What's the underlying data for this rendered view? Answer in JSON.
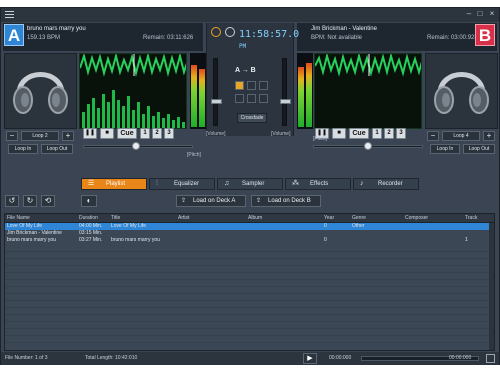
{
  "deckA": {
    "letter": "A",
    "song": "bruno mars marry you",
    "bpm": "159.13 BPM",
    "remain": "Remain: 03:11:626",
    "loop_label": "Loop 2",
    "loop_in": "Loop In",
    "loop_out": "Loop Out",
    "cue": "Cue",
    "hot1": "1",
    "hot2": "2",
    "hot3": "3",
    "volume": "[Volume]",
    "pitch": "[Pitch]"
  },
  "deckB": {
    "letter": "B",
    "song": "Jim Brickman - Valentine",
    "bpm": "BPM: Not available",
    "remain": "Remain: 03:00:928",
    "loop_label": "Loop 4",
    "loop_in": "Loop In",
    "loop_out": "Loop Out",
    "cue": "Cue",
    "hot1": "1",
    "hot2": "2",
    "hot3": "3",
    "volume": "[Volume]",
    "pitch": "[Pitch]"
  },
  "mixer": {
    "clock": "11:58:57.0",
    "ampm": "PM",
    "ab_label": "A → B",
    "crossfade": "Crossfade"
  },
  "tabs": [
    {
      "label": "Playlist",
      "icon": "playlist-icon",
      "active": true
    },
    {
      "label": "Equalizer",
      "icon": "equalizer-icon",
      "active": false
    },
    {
      "label": "Sampler",
      "icon": "music-note-icon",
      "active": false
    },
    {
      "label": "Effects",
      "icon": "effects-icon",
      "active": false
    },
    {
      "label": "Recorder",
      "icon": "microphone-icon",
      "active": false
    }
  ],
  "toolbar": {
    "load_a": "Load on Deck A",
    "load_b": "Load on Deck B"
  },
  "table": {
    "columns": [
      "File Name",
      "Duration",
      "Title",
      "Artist",
      "Album",
      "Year",
      "Genre",
      "Composer",
      "Track"
    ],
    "rows": [
      {
        "file": "Love Of My Life",
        "duration": "04:00 Min.",
        "title": "Love Of My Life",
        "artist": "",
        "album": "",
        "year": "0",
        "genre": "Other",
        "composer": "",
        "track": ""
      },
      {
        "file": "Jim Brickman - Valentine",
        "duration": "03:15 Min.",
        "title": "",
        "artist": "",
        "album": "",
        "year": "",
        "genre": "",
        "composer": "",
        "track": ""
      },
      {
        "file": "bruno mars marry you",
        "duration": "03:27 Min.",
        "title": "bruno mars marry you",
        "artist": "",
        "album": "",
        "year": "0",
        "genre": "",
        "composer": "",
        "track": "1"
      }
    ]
  },
  "status": {
    "file_number": "File Number: 1 of 3",
    "total_length": "Total Length: 10:42:010",
    "pos_start": "00:00:000",
    "pos_end": "00:00:000"
  },
  "colors": {
    "deckA_accent": "#2f86d6",
    "deckB_accent": "#d9304a",
    "active_tab": "#e8861a",
    "waveform": "#22d05a"
  }
}
